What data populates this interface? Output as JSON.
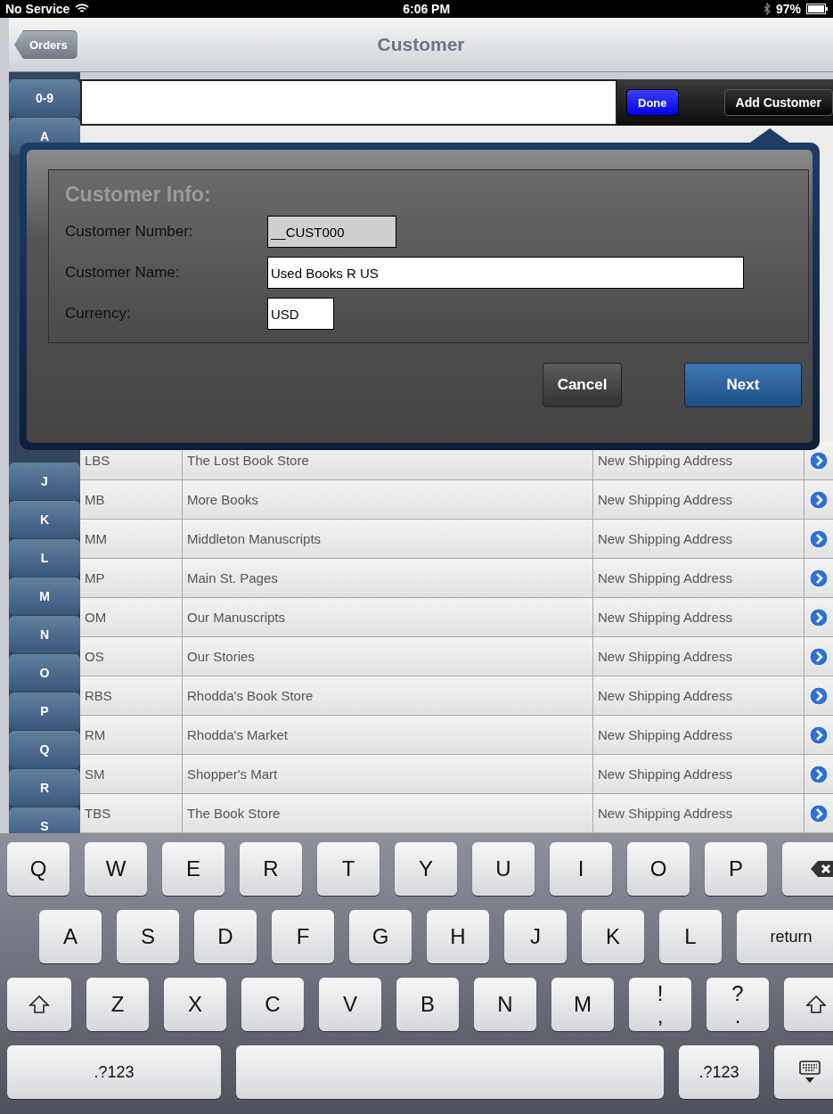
{
  "status_bar": {
    "carrier": "No Service",
    "time": "6:06 PM",
    "battery": "97%"
  },
  "nav_bar": {
    "back": "Orders",
    "title": "Customer"
  },
  "index": {
    "top": [
      "0-9",
      "A"
    ],
    "bottom": [
      "J",
      "K",
      "L",
      "M",
      "N",
      "O",
      "P",
      "Q",
      "R",
      "S"
    ]
  },
  "toolbar": {
    "done": "Done",
    "add": "Add Customer"
  },
  "rows": [
    {
      "code": "LBS",
      "name": "The Lost Book Store",
      "address": "New Shipping Address"
    },
    {
      "code": "MB",
      "name": "More Books",
      "address": "New Shipping Address"
    },
    {
      "code": "MM",
      "name": "Middleton Manuscripts",
      "address": "New Shipping Address"
    },
    {
      "code": "MP",
      "name": "Main St. Pages",
      "address": "New Shipping Address"
    },
    {
      "code": "OM",
      "name": "Our Manuscripts",
      "address": "New Shipping Address"
    },
    {
      "code": "OS",
      "name": "Our Stories",
      "address": "New Shipping Address"
    },
    {
      "code": "RBS",
      "name": "Rhodda's Book Store",
      "address": "New Shipping Address"
    },
    {
      "code": "RM",
      "name": "Rhodda's Market",
      "address": "New Shipping Address"
    },
    {
      "code": "SM",
      "name": "Shopper's Mart",
      "address": "New Shipping Address"
    },
    {
      "code": "TBS",
      "name": "The Book Store",
      "address": "New Shipping Address"
    }
  ],
  "dialog": {
    "title": "Customer Info:",
    "fields": [
      {
        "label": "Customer Number:",
        "value": "__CUST000",
        "kind": "number",
        "disabled": true
      },
      {
        "label": "Customer Name:",
        "value": "Used Books R US",
        "kind": "name",
        "disabled": false
      },
      {
        "label": "Currency:",
        "value": "USD",
        "kind": "currency",
        "disabled": false
      }
    ],
    "buttons": [
      {
        "label": "Cancel",
        "kind": "secondary"
      },
      {
        "label": "Next",
        "kind": "primary"
      }
    ]
  },
  "keyboard": {
    "rows": [
      {
        "keys": [
          {
            "kind": "char",
            "label": "Q"
          },
          {
            "kind": "char",
            "label": "W"
          },
          {
            "kind": "char",
            "label": "E"
          },
          {
            "kind": "char",
            "label": "R"
          },
          {
            "kind": "char",
            "label": "T"
          },
          {
            "kind": "char",
            "label": "Y"
          },
          {
            "kind": "char",
            "label": "U"
          },
          {
            "kind": "char",
            "label": "I"
          },
          {
            "kind": "char",
            "label": "O"
          },
          {
            "kind": "char",
            "label": "P"
          },
          {
            "kind": "backspace"
          }
        ]
      },
      {
        "keys": [
          {
            "kind": "char",
            "label": "A"
          },
          {
            "kind": "char",
            "label": "S"
          },
          {
            "kind": "char",
            "label": "D"
          },
          {
            "kind": "char",
            "label": "F"
          },
          {
            "kind": "char",
            "label": "G"
          },
          {
            "kind": "char",
            "label": "H"
          },
          {
            "kind": "char",
            "label": "J"
          },
          {
            "kind": "char",
            "label": "K"
          },
          {
            "kind": "char",
            "label": "L"
          },
          {
            "kind": "word",
            "label": "return"
          }
        ]
      },
      {
        "keys": [
          {
            "kind": "shift"
          },
          {
            "kind": "char",
            "label": "Z"
          },
          {
            "kind": "char",
            "label": "X"
          },
          {
            "kind": "char",
            "label": "C"
          },
          {
            "kind": "char",
            "label": "V"
          },
          {
            "kind": "char",
            "label": "B"
          },
          {
            "kind": "char",
            "label": "N"
          },
          {
            "kind": "char",
            "label": "M"
          },
          {
            "kind": "punct",
            "label": "!",
            "alt": ","
          },
          {
            "kind": "punct",
            "label": "?",
            "alt": "."
          },
          {
            "kind": "shift"
          }
        ]
      },
      {
        "keys": [
          {
            "kind": "mode",
            "label": ".?123"
          },
          {
            "kind": "space"
          },
          {
            "kind": "mode",
            "label": ".?123"
          },
          {
            "kind": "hide"
          }
        ]
      }
    ]
  }
}
